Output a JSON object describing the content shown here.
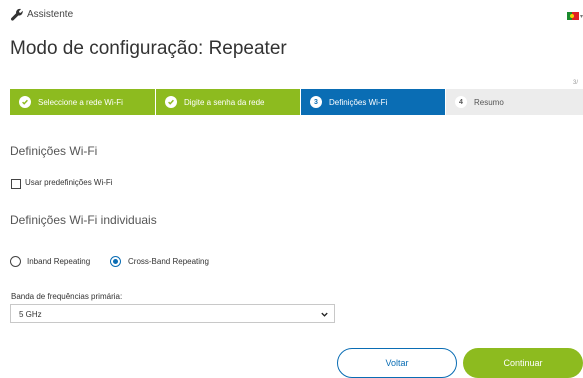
{
  "header": {
    "assistant_label": "Assistente",
    "flag_icon": "portugal-flag-icon"
  },
  "page": {
    "title": "Modo de configuração: Repeater",
    "page_indicator": "3/"
  },
  "steps": [
    {
      "label": "Seleccione a rede Wi-Fi",
      "state": "done"
    },
    {
      "label": "Digite a senha da rede",
      "state": "done"
    },
    {
      "number": "3",
      "label": "Definições Wi-Fi",
      "state": "active"
    },
    {
      "number": "4",
      "label": "Resumo",
      "state": "todo"
    }
  ],
  "wifi_settings": {
    "heading": "Definições Wi-Fi",
    "use_defaults_label": "Usar predefinições Wi-Fi",
    "use_defaults_checked": false
  },
  "individual_settings": {
    "heading": "Definições Wi-Fi individuais",
    "options": [
      {
        "label": "Inband Repeating",
        "selected": false
      },
      {
        "label": "Cross-Band Repeating",
        "selected": true
      }
    ],
    "band_label": "Banda de frequências primária:",
    "band_value": "5 GHz"
  },
  "buttons": {
    "back": "Voltar",
    "next": "Continuar"
  },
  "colors": {
    "green": "#8dbb1f",
    "blue": "#0a6db4",
    "grey": "#ececec"
  }
}
